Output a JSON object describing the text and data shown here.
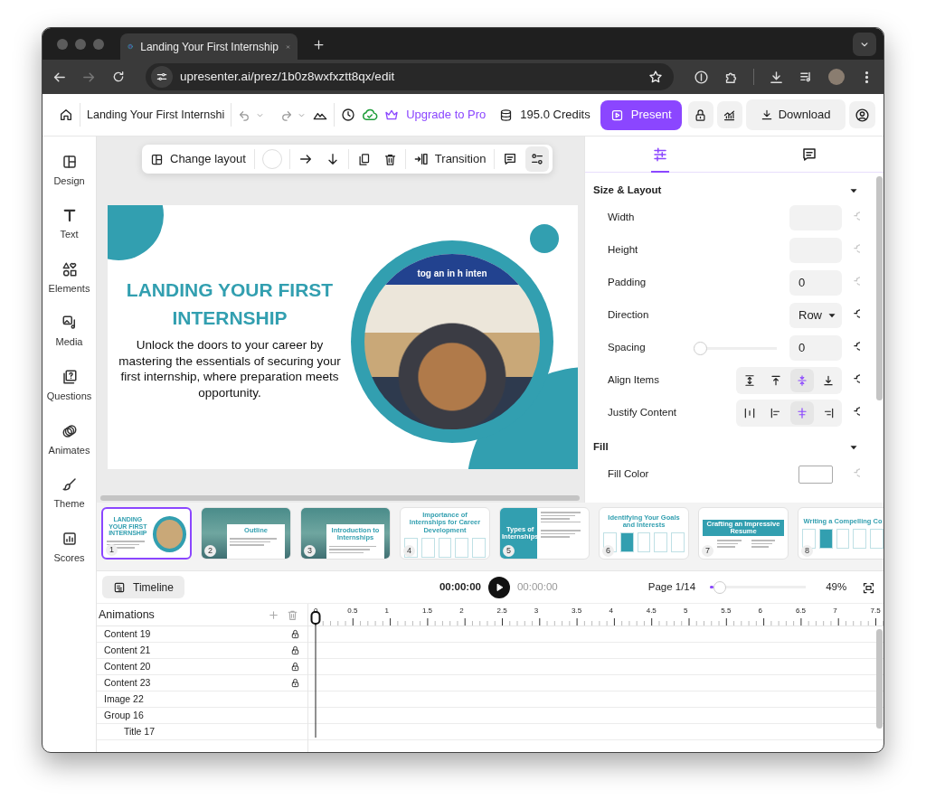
{
  "browser": {
    "tab": {
      "title": "Landing Your First Internship"
    },
    "back": {
      "disabled": false
    },
    "forward": {
      "disabled": true
    },
    "address": "upresenter.ai/prez/1b0z8wxfxztt8qx/edit"
  },
  "top_bar": {
    "title": "Landing Your First Internshi",
    "upgrade": "Upgrade to Pro",
    "credits": "195.0 Credits",
    "present": "Present",
    "download": "Download"
  },
  "sidebar": {
    "items": [
      {
        "kind": "design",
        "label": "Design"
      },
      {
        "kind": "text",
        "label": "Text"
      },
      {
        "kind": "elements",
        "label": "Elements"
      },
      {
        "kind": "media",
        "label": "Media"
      },
      {
        "kind": "questions",
        "label": "Questions"
      },
      {
        "kind": "animates",
        "label": "Animates"
      },
      {
        "kind": "theme",
        "label": "Theme"
      },
      {
        "kind": "scores",
        "label": "Scores"
      }
    ]
  },
  "floating_toolbar": {
    "change_layout": "Change layout",
    "transition": "Transition",
    "settings_active": true
  },
  "slide": {
    "title": "LANDING YOUR FIRST INTERNSHIP",
    "subtitle": "Unlock the doors to your career by mastering the essentials of securing your first internship, where preparation meets opportunity.",
    "image_banner": "tog an in h inten"
  },
  "properties": {
    "tabs": [
      {
        "kind": "style",
        "selected": true
      },
      {
        "kind": "comments",
        "selected": false
      }
    ],
    "sections": [
      {
        "title": "Size & Layout",
        "expanded": true,
        "rows": [
          {
            "kind": "field",
            "label": "Width",
            "reset_enabled": false
          },
          {
            "kind": "field",
            "label": "Height",
            "reset_enabled": false
          },
          {
            "kind": "field",
            "label": "Padding",
            "value": "0",
            "reset_enabled": false
          },
          {
            "kind": "select",
            "label": "Direction",
            "value": "Row",
            "reset_enabled": true
          },
          {
            "kind": "slider",
            "label": "Spacing",
            "level": 0,
            "value": "0",
            "reset_enabled": true
          },
          {
            "kind": "segmented",
            "label": "Align Items",
            "reset_enabled": true,
            "options": [
              {
                "kind": "align-stretch",
                "selected": false
              },
              {
                "kind": "align-start",
                "selected": false
              },
              {
                "kind": "align-center",
                "selected": true
              },
              {
                "kind": "align-end",
                "selected": false
              }
            ]
          },
          {
            "kind": "segmented",
            "label": "Justify Content",
            "reset_enabled": true,
            "options": [
              {
                "kind": "space-between",
                "selected": false
              },
              {
                "kind": "justify-start",
                "selected": false
              },
              {
                "kind": "justify-center",
                "selected": true
              },
              {
                "kind": "justify-end",
                "selected": false
              }
            ]
          }
        ]
      },
      {
        "title": "Fill",
        "expanded": true,
        "rows": [
          {
            "kind": "color",
            "label": "Fill Color",
            "reset_enabled": false
          }
        ]
      }
    ]
  },
  "thumbnails": [
    {
      "number": "1",
      "kind": "title",
      "title": "LANDING YOUR FIRST INTERNSHIP",
      "selected": true
    },
    {
      "number": "2",
      "kind": "photo",
      "title": "Outline",
      "selected": false
    },
    {
      "number": "3",
      "kind": "photo",
      "title": "Introduction to Internships",
      "selected": false
    },
    {
      "number": "4",
      "kind": "columns",
      "title": "Importance of Internships for Career Development",
      "selected": false
    },
    {
      "number": "5",
      "kind": "sidebar",
      "title": "Types of Internships",
      "selected": false
    },
    {
      "number": "6",
      "kind": "columns",
      "title": "Identifying Your Goals and Interests",
      "selected": false
    },
    {
      "number": "7",
      "kind": "banner",
      "title": "Crafting an Impressive Resume",
      "selected": false
    },
    {
      "number": "8",
      "kind": "columns",
      "title": "Writing a Compelling Co",
      "selected": false
    }
  ],
  "timeline": {
    "button": "Timeline",
    "current_time": "00:00:00",
    "total_time": "00:00:00",
    "page": "Page 1/14",
    "zoom": {
      "level": 0.04
    },
    "zoom_label": "49%",
    "layers_title": "Animations",
    "ruler": [
      "0",
      "0.5",
      "1",
      "1.5",
      "2",
      "2.5",
      "3",
      "3.5",
      "4",
      "4.5",
      "5",
      "5.5",
      "6",
      "6.5",
      "7",
      "7.5"
    ],
    "layers": [
      {
        "name": "Content 19",
        "locked": true
      },
      {
        "name": "Content 21",
        "locked": true
      },
      {
        "name": "Content 20",
        "locked": true
      },
      {
        "name": "Content 23",
        "locked": true
      },
      {
        "name": "Image 22",
        "locked": false
      },
      {
        "name": "Group 16",
        "locked": false,
        "children": [
          {
            "name": "Title 17",
            "locked": false
          }
        ]
      }
    ]
  }
}
